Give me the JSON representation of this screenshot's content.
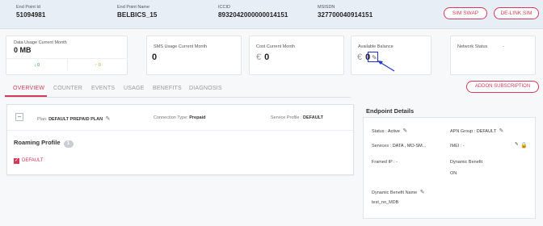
{
  "header": {
    "fields": [
      {
        "label": "End Point Id",
        "value": "51094981"
      },
      {
        "label": "End Point Name",
        "value": "BELBICS_15"
      },
      {
        "label": "ICCID",
        "value": "8932042000000014151"
      },
      {
        "label": "MSISDN",
        "value": "327700040914151"
      }
    ],
    "buttons": [
      "SIM SWAP",
      "DE-LINK SIM"
    ]
  },
  "cards": {
    "data_usage": {
      "label": "Data Usage Current Month",
      "value": "0 MB",
      "down": "↓ 0",
      "up": "↑ 0"
    },
    "sms_usage": {
      "label": "SMS Usage Current Month",
      "value": "0"
    },
    "cost": {
      "label": "Cost Current Month",
      "currency": "€",
      "value": "0"
    },
    "balance": {
      "label": "Available Balance",
      "currency": "€",
      "value": "0"
    },
    "network": {
      "label": "Network Status",
      "value": "-"
    }
  },
  "tabs": [
    "OVERVIEW",
    "COUNTER",
    "EVENTS",
    "USAGE",
    "BENEFITS",
    "DIAGNOSIS"
  ],
  "active_tab": "OVERVIEW",
  "addon_button": "ADDON SUBSCRIPTION",
  "plan": {
    "collapse": "−",
    "plan_label": "Plan:",
    "plan_value": "DEFAULT PREPAID PLAN",
    "conn_label": "Connection Type:",
    "conn_value": "Prepaid",
    "svc_label": "Service Profile :",
    "svc_value": "DEFAULT"
  },
  "roaming": {
    "title": "Roaming Profile",
    "count": "1",
    "item": "DEFAULT"
  },
  "endpoint": {
    "title": "Endpoint Details",
    "status_label": "Status :",
    "status_value": "Active",
    "apn_label": "APN Group :",
    "apn_value": "DEFAULT",
    "services_label": "Services :",
    "services_value": "DATA , MO-SM...",
    "imei_label": "IMEI :",
    "imei_value": "-",
    "framed_label": "Framed IP :",
    "framed_value": "-",
    "dyn_benefit_label": "Dynamic Benefit",
    "dyn_benefit_value": "ON",
    "dyn_name_label": "Dynamic Benefit Name",
    "dyn_name_value": "test_no_MDB"
  },
  "colors": {
    "accent": "#d23c5a",
    "header_bg": "#e7eef5",
    "annotation": "#2333c9"
  }
}
